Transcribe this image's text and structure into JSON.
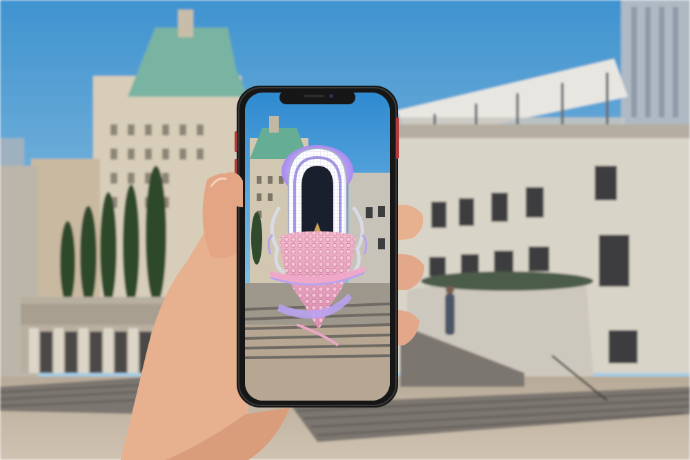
{
  "scene": {
    "sky_top": "#3f93cf",
    "sky_bottom": "#bcd9ea",
    "building_left": "#d7cdb8",
    "roof_green": "#79b3a1",
    "building_right": "#d9d4c8",
    "plaza": "#c2b4a2",
    "stairs": "#7b7670",
    "tree": "#2f4a2c",
    "phone_frame": "#161616",
    "phone_accent": "#b23a3a",
    "skin": "#e7b08f",
    "ar_purple": "#b9a2f0",
    "ar_pink": "#e9a7c7",
    "ar_silver": "#d8dbe6"
  },
  "icons": {
    "hand": "hand-icon",
    "phone": "smartphone-icon",
    "ar_object": "ar-sculpture-icon"
  }
}
